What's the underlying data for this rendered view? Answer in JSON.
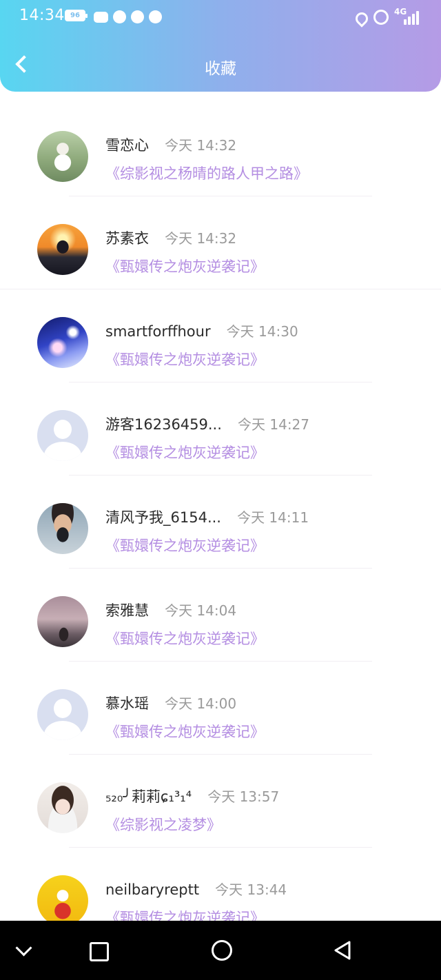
{
  "status_bar": {
    "time": "14:34",
    "battery": "96",
    "network": "4G"
  },
  "header": {
    "title": "收藏"
  },
  "items": [
    {
      "name": "雪恋心",
      "time": "今天 14:32",
      "book": "《综影视之杨晴的路人甲之路》",
      "avatar": "photo-girl-garden"
    },
    {
      "name": "苏素衣",
      "time": "今天 14:32",
      "book": "《甄嬛传之炮灰逆袭记》",
      "avatar": "photo-sunset"
    },
    {
      "name": "smartforffhour",
      "time": "今天 14:30",
      "book": "《甄嬛传之炮灰逆袭记》",
      "avatar": "photo-night-house"
    },
    {
      "name": "游客16236459...",
      "time": "今天 14:27",
      "book": "《甄嬛传之炮灰逆袭记》",
      "avatar": "default"
    },
    {
      "name": "清风予我_6154...",
      "time": "今天 14:11",
      "book": "《甄嬛传之炮灰逆袭记》",
      "avatar": "photo-man-mask"
    },
    {
      "name": "索雅慧",
      "time": "今天 14:04",
      "book": "《甄嬛传之炮灰逆袭记》",
      "avatar": "photo-dusk-girl"
    },
    {
      "name": "慕水瑶",
      "time": "今天 14:00",
      "book": "《甄嬛传之炮灰逆袭记》",
      "avatar": "default"
    },
    {
      "name": "₅₂₀╯莉莉ɕ₁³₁⁴",
      "time": "今天 13:57",
      "book": "《综影视之凌梦》",
      "avatar": "photo-bride"
    },
    {
      "name": "neilbaryreptt",
      "time": "今天 13:44",
      "book": "《甄嬛传之炮灰逆袭记》",
      "avatar": "photo-cartoon-yellow"
    }
  ]
}
